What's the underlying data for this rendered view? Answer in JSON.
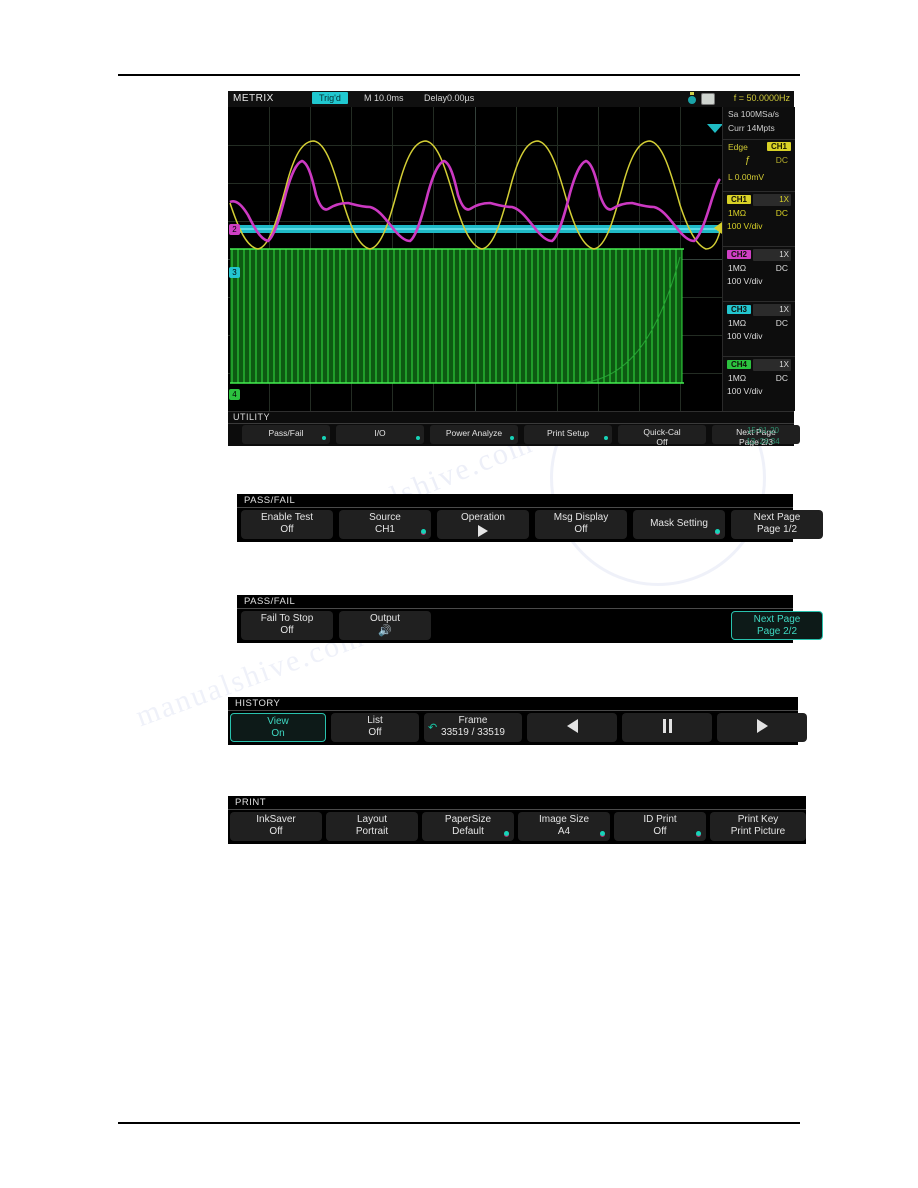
{
  "scope": {
    "brand": "METRIX",
    "status_badge": "Trig'd",
    "time_scale": "M 10.0ms",
    "delay": "Delay0.00µs",
    "frequency": "f = 50.0000Hz",
    "icons": {
      "usb": "usb-icon",
      "display": "display-icon"
    },
    "acquisition": {
      "sample_rate": "Sa 100MSa/s",
      "memory_depth": "Curr 14Mpts"
    },
    "trigger": {
      "type": "Edge",
      "source": "CH1",
      "slope": "ƒ",
      "coupling": "DC",
      "level": "L  0.00mV"
    },
    "channels": [
      {
        "name": "CH1",
        "probe": "1X",
        "impedance": "1MΩ",
        "coupling": "DC",
        "scale": "100 V/div",
        "color": "#d9d227"
      },
      {
        "name": "CH2",
        "probe": "1X",
        "impedance": "1MΩ",
        "coupling": "DC",
        "scale": "100 V/div",
        "color": "#cf3fc4"
      },
      {
        "name": "CH3",
        "probe": "1X",
        "impedance": "1MΩ",
        "coupling": "DC",
        "scale": "100 V/div",
        "color": "#23c6cf"
      },
      {
        "name": "CH4",
        "probe": "1X",
        "impedance": "1MΩ",
        "coupling": "DC",
        "scale": "100 V/div",
        "color": "#2cc23f"
      }
    ],
    "menu": {
      "title": "UTILITY",
      "buttons": [
        {
          "l1": "Pass/Fail",
          "l2": "",
          "dot": true
        },
        {
          "l1": "I/O",
          "l2": "",
          "dot": true
        },
        {
          "l1": "Power Analyze",
          "l2": "",
          "dot": true
        },
        {
          "l1": "Print Setup",
          "l2": "",
          "dot": true
        },
        {
          "l1": "Quick-Cal",
          "l2": "Off",
          "dot": false
        },
        {
          "l1": "Next Page",
          "l2": "Page 2/3",
          "dot": false
        }
      ],
      "date": "15-01-20",
      "time": "13 :26:34"
    }
  },
  "passfail_page1": {
    "title": "PASS/FAIL",
    "buttons": [
      {
        "l1": "Enable Test",
        "l2": "Off",
        "dot": false,
        "selected": false
      },
      {
        "l1": "Source",
        "l2": "CH1",
        "dot": true,
        "selected": false
      },
      {
        "l1": "Operation",
        "l2": "",
        "icon": "play-icon",
        "dot": false,
        "selected": false
      },
      {
        "l1": "Msg Display",
        "l2": "Off",
        "dot": false,
        "selected": false
      },
      {
        "l1": "Mask  Setting",
        "l2": "",
        "dot": true,
        "selected": false
      },
      {
        "l1": "Next Page",
        "l2": "Page 1/2",
        "dot": false,
        "selected": false
      }
    ]
  },
  "passfail_page2": {
    "title": "PASS/FAIL",
    "buttons": [
      {
        "l1": "Fail To  Stop",
        "l2": "Off",
        "dot": false,
        "selected": false
      },
      {
        "l1": "Output",
        "l2": "",
        "icon": "speaker-icon",
        "dot": false,
        "selected": false
      },
      {
        "l1": "Next Page",
        "l2": "Page 2/2",
        "dot": false,
        "selected": true
      }
    ]
  },
  "history": {
    "title": "HISTORY",
    "buttons": [
      {
        "l1": "View",
        "l2": "On",
        "dot": false,
        "selected": true
      },
      {
        "l1": "List",
        "l2": "Off",
        "dot": false,
        "selected": false
      },
      {
        "l1": "Frame",
        "l2": "33519 / 33519",
        "icon": "rotate-icon",
        "dot": false,
        "selected": false
      },
      {
        "l1": "",
        "l2": "",
        "icon": "prev-icon",
        "dot": false,
        "selected": false
      },
      {
        "l1": "",
        "l2": "",
        "icon": "pause-icon",
        "dot": false,
        "selected": false
      },
      {
        "l1": "",
        "l2": "",
        "icon": "next-icon",
        "dot": false,
        "selected": false
      }
    ]
  },
  "print": {
    "title": "PRINT",
    "buttons": [
      {
        "l1": "InkSaver",
        "l2": "Off",
        "dot": false
      },
      {
        "l1": "Layout",
        "l2": "Portrait",
        "dot": false
      },
      {
        "l1": "PaperSize",
        "l2": "Default",
        "dot": true
      },
      {
        "l1": "Image Size",
        "l2": "A4",
        "dot": true
      },
      {
        "l1": "ID Print",
        "l2": "Off",
        "dot": true
      },
      {
        "l1": "Print Key",
        "l2": "Print Picture",
        "dot": false
      }
    ]
  },
  "watermark": {
    "line1": "manualshive.com",
    "line2": "manualshive.com"
  }
}
